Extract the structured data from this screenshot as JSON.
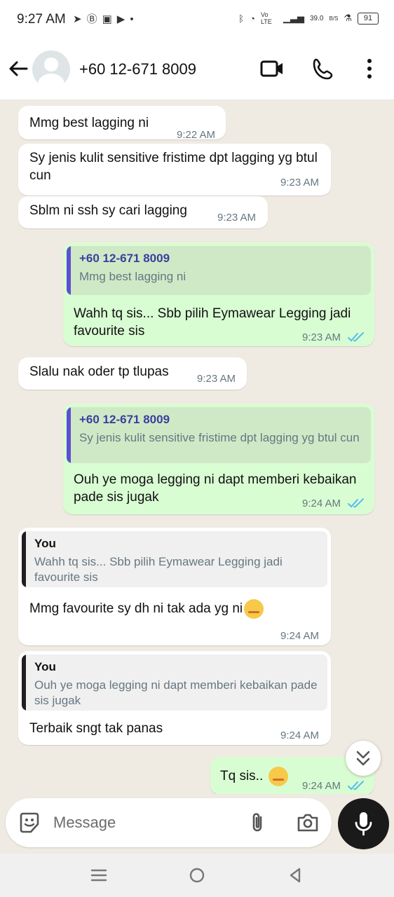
{
  "status_bar": {
    "time": "9:27 AM",
    "left_icons": [
      "telegram-icon",
      "b-icon",
      "flipboard-icon",
      "youtube-icon",
      "dot-icon"
    ],
    "network_label": "Vo LTE",
    "speed": "39.0",
    "speed_unit": "B/S",
    "battery": "91"
  },
  "header": {
    "contact_name": "+60 12-671 8009",
    "icons": [
      "back-arrow-icon",
      "video-call-icon",
      "voice-call-icon",
      "more-options-icon"
    ]
  },
  "messages": [
    {
      "dir": "in",
      "text": "Mmg best lagging ni",
      "time": "9:22 AM"
    },
    {
      "dir": "in",
      "text": "Sy jenis kulit sensitive fristime dpt lagging yg btul cun",
      "time": "9:23 AM"
    },
    {
      "dir": "in",
      "text": "Sblm ni ssh sy cari lagging",
      "time": "9:23 AM"
    },
    {
      "dir": "out",
      "quote_name": "+60 12-671 8009",
      "quote_text": "Mmg best lagging ni",
      "text": "Wahh tq sis... Sbb pilih Eymawear Legging jadi favourite sis",
      "time": "9:23 AM"
    },
    {
      "dir": "in",
      "text": "Slalu nak oder tp tlupas",
      "time": "9:23 AM"
    },
    {
      "dir": "out",
      "quote_name": "+60 12-671 8009",
      "quote_text": "Sy jenis kulit sensitive fristime dpt lagging yg btul cun",
      "text": "Ouh ye moga legging ni dapt memberi kebaikan pade sis jugak",
      "time": "9:24 AM"
    },
    {
      "dir": "in",
      "quote_name": "You",
      "quote_text": "Wahh tq sis... Sbb pilih Eymawear Legging jadi favourite sis",
      "text": "Mmg favourite sy dh ni tak ada yg ni",
      "time": "9:24 AM"
    },
    {
      "dir": "in",
      "quote_name": "You",
      "quote_text": "Ouh ye moga legging ni dapt memberi kebaikan pade sis jugak",
      "text": "Terbaik sngt tak panas",
      "time": "9:24 AM"
    },
    {
      "dir": "out",
      "text": "Tq sis..",
      "time": "9:24 AM"
    }
  ],
  "input": {
    "placeholder": "Message"
  },
  "colors": {
    "chat_bg": "#efeae2",
    "outgoing_bubble": "#d9fdd3",
    "incoming_bubble": "#ffffff",
    "quote_bar_contact": "#5e4fd1",
    "quote_bar_you": "#1f1f1f",
    "read_ticks": "#53bdeb"
  }
}
